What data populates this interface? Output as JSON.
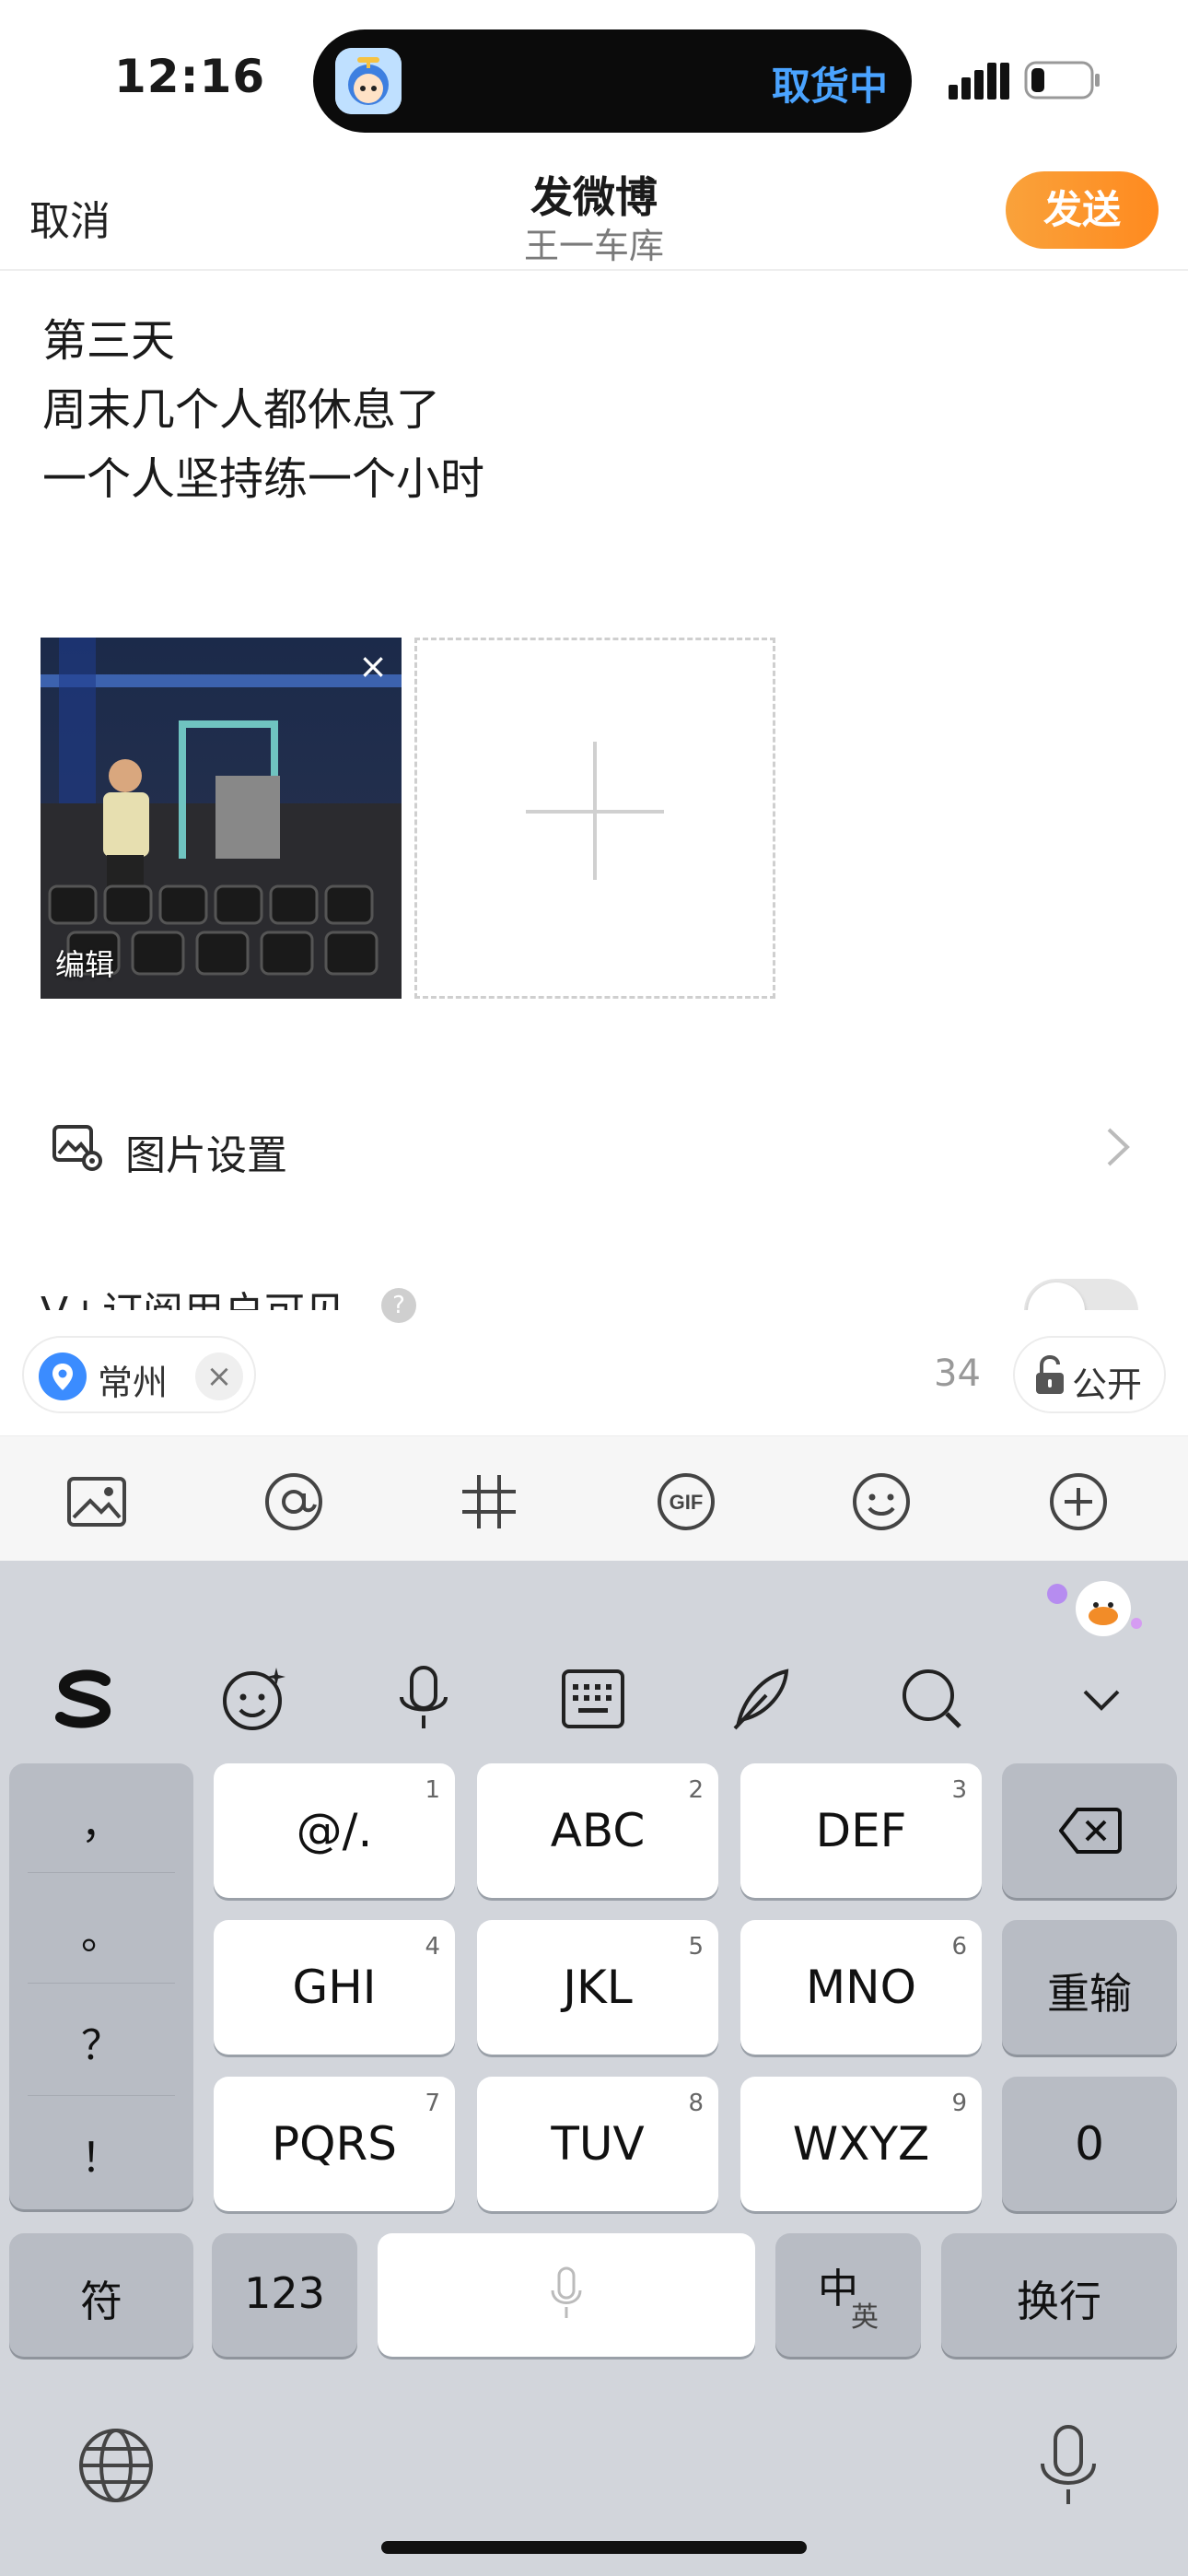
{
  "status_bar": {
    "time": "12:16",
    "island_text": "取货中"
  },
  "header": {
    "cancel_label": "取消",
    "title": "发微博",
    "subtitle": "王一车库",
    "send_label": "发送"
  },
  "post": {
    "lines": [
      "第三天",
      "周末几个人都休息了",
      "一个人坚持练一个小时"
    ]
  },
  "media": {
    "edit_label": "编辑",
    "close_symbol": "×"
  },
  "settings": {
    "image_settings_label": "图片设置",
    "vplus_label": "V+订阅用户可见",
    "help_symbol": "?"
  },
  "location": {
    "city": "常州",
    "close_symbol": "×"
  },
  "char_count": "34",
  "visibility_label": "公开",
  "toolbar_icons": [
    "image-icon",
    "at-icon",
    "hashtag-icon",
    "gif-icon",
    "emoji-icon",
    "plus-circle-icon"
  ],
  "keyboard": {
    "tools": [
      "sogou-logo-icon",
      "emoji-plus-icon",
      "voice-icon",
      "keyboard-icon",
      "handwriting-icon",
      "search-icon",
      "collapse-icon"
    ],
    "punctuation": [
      "，",
      "。",
      "？",
      "！"
    ],
    "keys": {
      "k1": {
        "label": "@/.",
        "num": "1"
      },
      "k2": {
        "label": "ABC",
        "num": "2"
      },
      "k3": {
        "label": "DEF",
        "num": "3"
      },
      "k4": {
        "label": "GHI",
        "num": "4"
      },
      "k5": {
        "label": "JKL",
        "num": "5"
      },
      "k6": {
        "label": "MNO",
        "num": "6"
      },
      "k7": {
        "label": "PQRS",
        "num": "7"
      },
      "k8": {
        "label": "TUV",
        "num": "8"
      },
      "k9": {
        "label": "WXYZ",
        "num": "9"
      }
    },
    "retype_label": "重输",
    "zero_label": "0",
    "symbol_label": "符",
    "num_label": "123",
    "lang_main": "中",
    "lang_sub": "英",
    "newline_label": "换行"
  },
  "colors": {
    "accent": "#ff8a1f",
    "link_blue": "#4aa3ff",
    "location_blue": "#3b8cff"
  }
}
